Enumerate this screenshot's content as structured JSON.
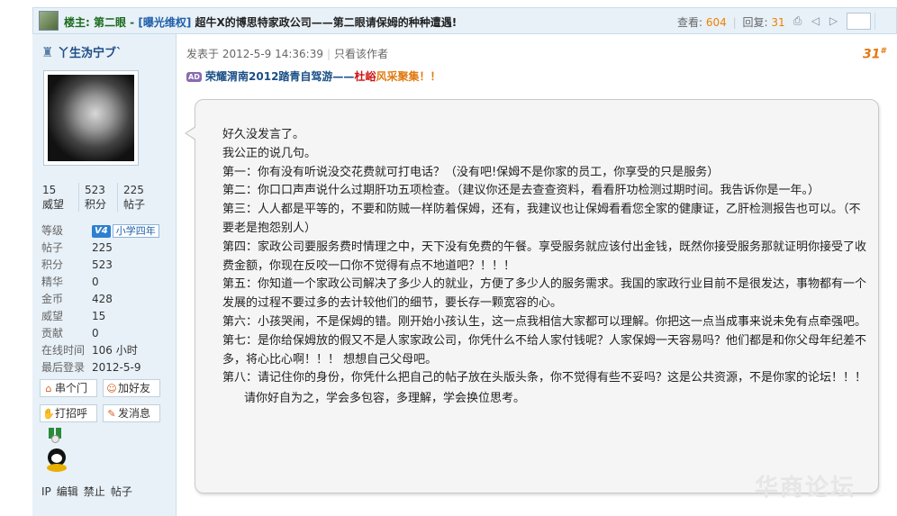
{
  "topbar": {
    "prefix": "楼主: 第二眼 - ",
    "badge": "[曝光维权]",
    "title": " 超牛X的博思特家政公司——第二眼请保姆的种种遭遇!",
    "views_label": "查看: ",
    "views": "604",
    "replies_label": "回复: ",
    "replies": "31"
  },
  "user": {
    "name": "丫生沩宁ブ`",
    "stats": [
      {
        "value": "15",
        "label": "威望"
      },
      {
        "value": "523",
        "label": "积分"
      },
      {
        "value": "225",
        "label": "帖子"
      }
    ],
    "level_label": "等级",
    "level_tag": "V4",
    "level_name": "小学四年",
    "info": [
      {
        "k": "帖子",
        "v": "225"
      },
      {
        "k": "积分",
        "v": "523"
      },
      {
        "k": "精华",
        "v": "0"
      },
      {
        "k": "金币",
        "v": "428"
      },
      {
        "k": "威望",
        "v": "15"
      },
      {
        "k": "贡献",
        "v": "0"
      },
      {
        "k": "在线时间",
        "v": "106 小时"
      },
      {
        "k": "最后登录",
        "v": "2012-5-9"
      }
    ],
    "buttons": {
      "visit": "串个门",
      "add_friend": "加好友",
      "greet": "打招呼",
      "message": "发消息"
    },
    "footer": [
      "IP",
      "编辑",
      "禁止",
      "帖子"
    ]
  },
  "post": {
    "posted": "发表于 2012-5-9 14:36:39",
    "only_author": "只看该作者",
    "floor": "31",
    "floor_sup": "#",
    "ad_tag": "AD",
    "ad_part1": "荣耀渭南2012踏青自驾游——",
    "ad_part2": "杜峪",
    "ad_part3": "风采聚集！！",
    "lines": [
      "好久没发言了。",
      "我公正的说几句。",
      "第一：你有没有听说没交花费就可打电话？（没有吧!保姆不是你家的员工，你享受的只是服务）",
      "第二：你口口声声说什么过期肝功五项检查。（建议你还是去查查资料，看看肝功检测过期时间。我告诉你是一年。）",
      "第三：人人都是平等的，不要和防贼一样防着保姆，还有，我建议也让保姆看看您全家的健康证，乙肝检测报告也可以。（不要老是抱怨别人）",
      "第四：家政公司要服务费时情理之中，天下没有免费的午餐。享受服务就应该付出金钱，既然你接受服务那就证明你接受了收费金额，你现在反咬一口你不觉得有点不地道吧？！！！",
      "第五：你知道一个家政公司解决了多少人的就业，方便了多少人的服务需求。我国的家政行业目前不是很发达，事物都有一个发展的过程不要过多的去计较他们的细节，要长存一颗宽容的心。",
      "第六：小孩哭闹，不是保姆的错。刚开始小孩认生，这一点我相信大家都可以理解。你把这一点当成事来说未免有点牵强吧。",
      "第七：是你给保姆放的假又不是人家家政公司，你凭什么不给人家付钱呢？人家保姆一天容易吗？他们都是和你父母年纪差不多，将心比心啊！！！  想想自己父母吧。",
      "第八：请记住你的身份，你凭什么把自己的帖子放在头版头条，你不觉得有些不妥吗？这是公共资源，不是你家的论坛！！！"
    ],
    "closing": "请你好自为之，学会多包容，多理解，学会换位思考。"
  },
  "watermark": "华商论坛"
}
